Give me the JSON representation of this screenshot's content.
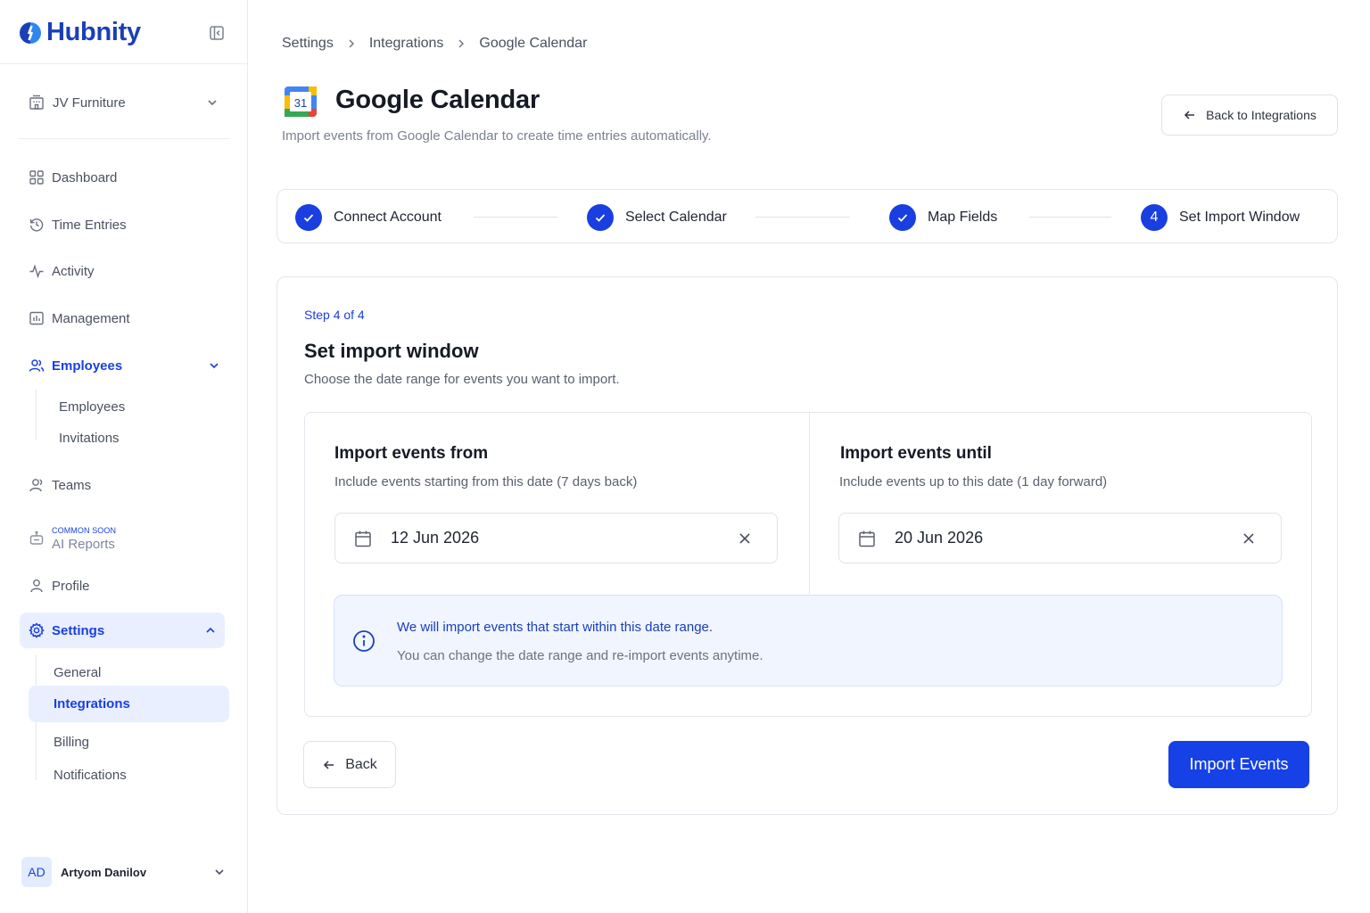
{
  "app": {
    "brand": "Hubnity"
  },
  "sidebar": {
    "org": "JV Furniture",
    "items": {
      "dashboard": "Dashboard",
      "time_entries": "Time Entries",
      "activity": "Activity",
      "management": "Management",
      "employees": "Employees",
      "teams": "Teams",
      "ai_reports": "AI Reports",
      "ai_badge": "COMMON SOON",
      "profile": "Profile",
      "settings": "Settings"
    },
    "employees_sub": [
      "Employees",
      "Invitations"
    ],
    "settings_sub": [
      "General",
      "Integrations",
      "Billing",
      "Notifications"
    ],
    "user": {
      "initials": "AD",
      "name": "Artyom Danilov"
    }
  },
  "breadcrumb": [
    "Settings",
    "Integrations",
    "Google Calendar"
  ],
  "header": {
    "logo_text": "31",
    "title": "Google Calendar",
    "subtitle": "Import events from Google Calendar to create time entries automatically.",
    "back_button": "Back to Integrations"
  },
  "stepper": {
    "steps": [
      {
        "label": "Connect Account",
        "state": "done"
      },
      {
        "label": "Select Calendar",
        "state": "done"
      },
      {
        "label": "Map Fields",
        "state": "done"
      },
      {
        "label": "Set Import Window",
        "state": "current",
        "number": "4"
      }
    ]
  },
  "card": {
    "step_count": "Step 4 of 4",
    "title": "Set import window",
    "subtitle": "Choose the date range for events you want to import.",
    "from": {
      "title": "Import events from",
      "subtitle": "Include events starting from this date (7 days back)",
      "value": "12 Jun 2026"
    },
    "until": {
      "title": "Import events until",
      "subtitle": "Include events up to this date (1 day forward)",
      "value": "20 Jun 2026"
    },
    "info": {
      "line1": "We will import events that start within this date range.",
      "line2": "You can change the date range and re-import events anytime."
    },
    "back_label": "Back",
    "import_label": "Import Events"
  },
  "colors": {
    "accent": "#1641e6",
    "brand": "#1a3fb8",
    "info_bg": "#f0f5ff"
  }
}
